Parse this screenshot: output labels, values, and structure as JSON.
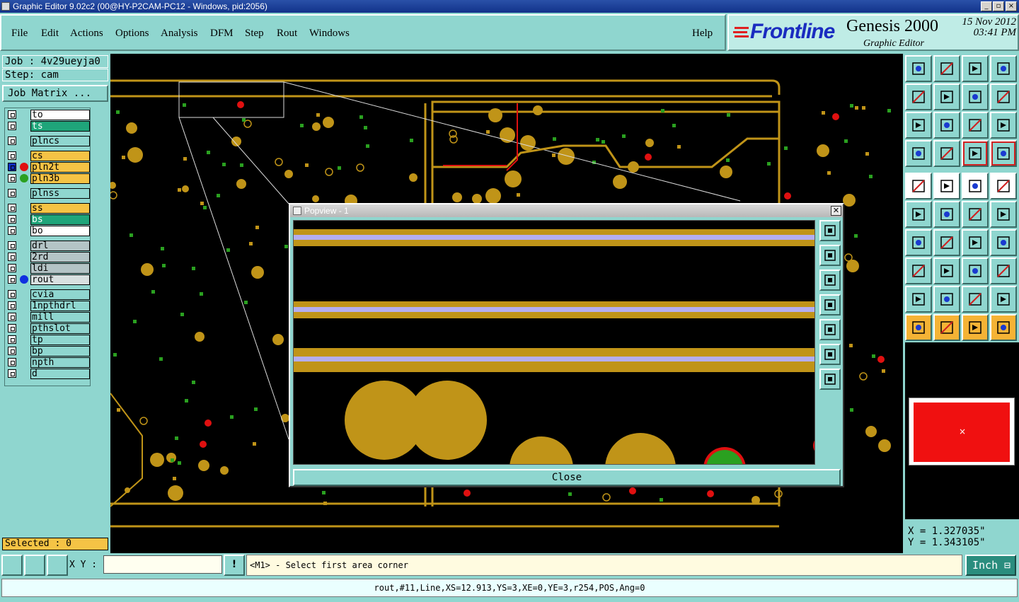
{
  "window": {
    "title": "Graphic Editor 9.02c2 (00@HY-P2CAM-PC12 - Windows, pid:2056)"
  },
  "menu": {
    "items": [
      "File",
      "Edit",
      "Actions",
      "Options",
      "Analysis",
      "DFM",
      "Step",
      "Rout",
      "Windows"
    ],
    "help": "Help"
  },
  "brand": {
    "logo": "Frontline",
    "product": "Genesis 2000",
    "subtitle": "Graphic Editor",
    "date": "15 Nov 2012",
    "time": "03:41 PM"
  },
  "job": {
    "job_label": "Job : 4v29ueyja0",
    "step_label": "Step: cam",
    "matrix_button": "Job Matrix ..."
  },
  "layers": [
    {
      "name": "to",
      "color": "#ffffff"
    },
    {
      "name": "ts",
      "color": "#1fa57a"
    },
    {
      "name": "plncs",
      "color": "#8fd6cf"
    },
    {
      "name": "cs",
      "color": "#f5c345"
    },
    {
      "name": "pln2t",
      "color": "#f5c345",
      "dot": "#e01010",
      "active": true
    },
    {
      "name": "pln3b",
      "color": "#f5c345",
      "dot": "#2aa020"
    },
    {
      "name": "plnss",
      "color": "#8fd6cf"
    },
    {
      "name": "ss",
      "color": "#f5c345"
    },
    {
      "name": "bs",
      "color": "#1fa57a"
    },
    {
      "name": "bo",
      "color": "#ffffff"
    },
    {
      "name": "drl",
      "color": "#b4c4c6"
    },
    {
      "name": "2rd",
      "color": "#b4c4c6"
    },
    {
      "name": "ldi",
      "color": "#b4c4c6"
    },
    {
      "name": "rout",
      "color": "#d8e0e0",
      "dot": "#1030e0"
    },
    {
      "name": "cvia",
      "color": "#8fd6cf"
    },
    {
      "name": "1npthdrl",
      "color": "#8fd6cf"
    },
    {
      "name": "mill",
      "color": "#8fd6cf"
    },
    {
      "name": "pthslot",
      "color": "#8fd6cf"
    },
    {
      "name": "tp",
      "color": "#8fd6cf"
    },
    {
      "name": "bp",
      "color": "#8fd6cf"
    },
    {
      "name": "npth",
      "color": "#8fd6cf"
    },
    {
      "name": "d",
      "color": "#8fd6cf"
    }
  ],
  "selected_label": "Selected : 0",
  "popup": {
    "title": "Popview - 1",
    "close_label": "Close"
  },
  "coords": {
    "x": "X = 1.327035\"",
    "y": "Y = 1.343105\""
  },
  "bottom": {
    "xy_label": "X Y :",
    "xy_value": "",
    "prompt": "<M1> - Select first area corner",
    "unit": "Inch"
  },
  "status": "rout,#11,Line,XS=12.913,YS=3,XE=0,YE=3,r254,POS,Ang=0",
  "colors": {
    "pad": "#c09418",
    "trace_lilac": "#b4aef0",
    "background": "#8fd6cf",
    "canvas": "#000000"
  }
}
